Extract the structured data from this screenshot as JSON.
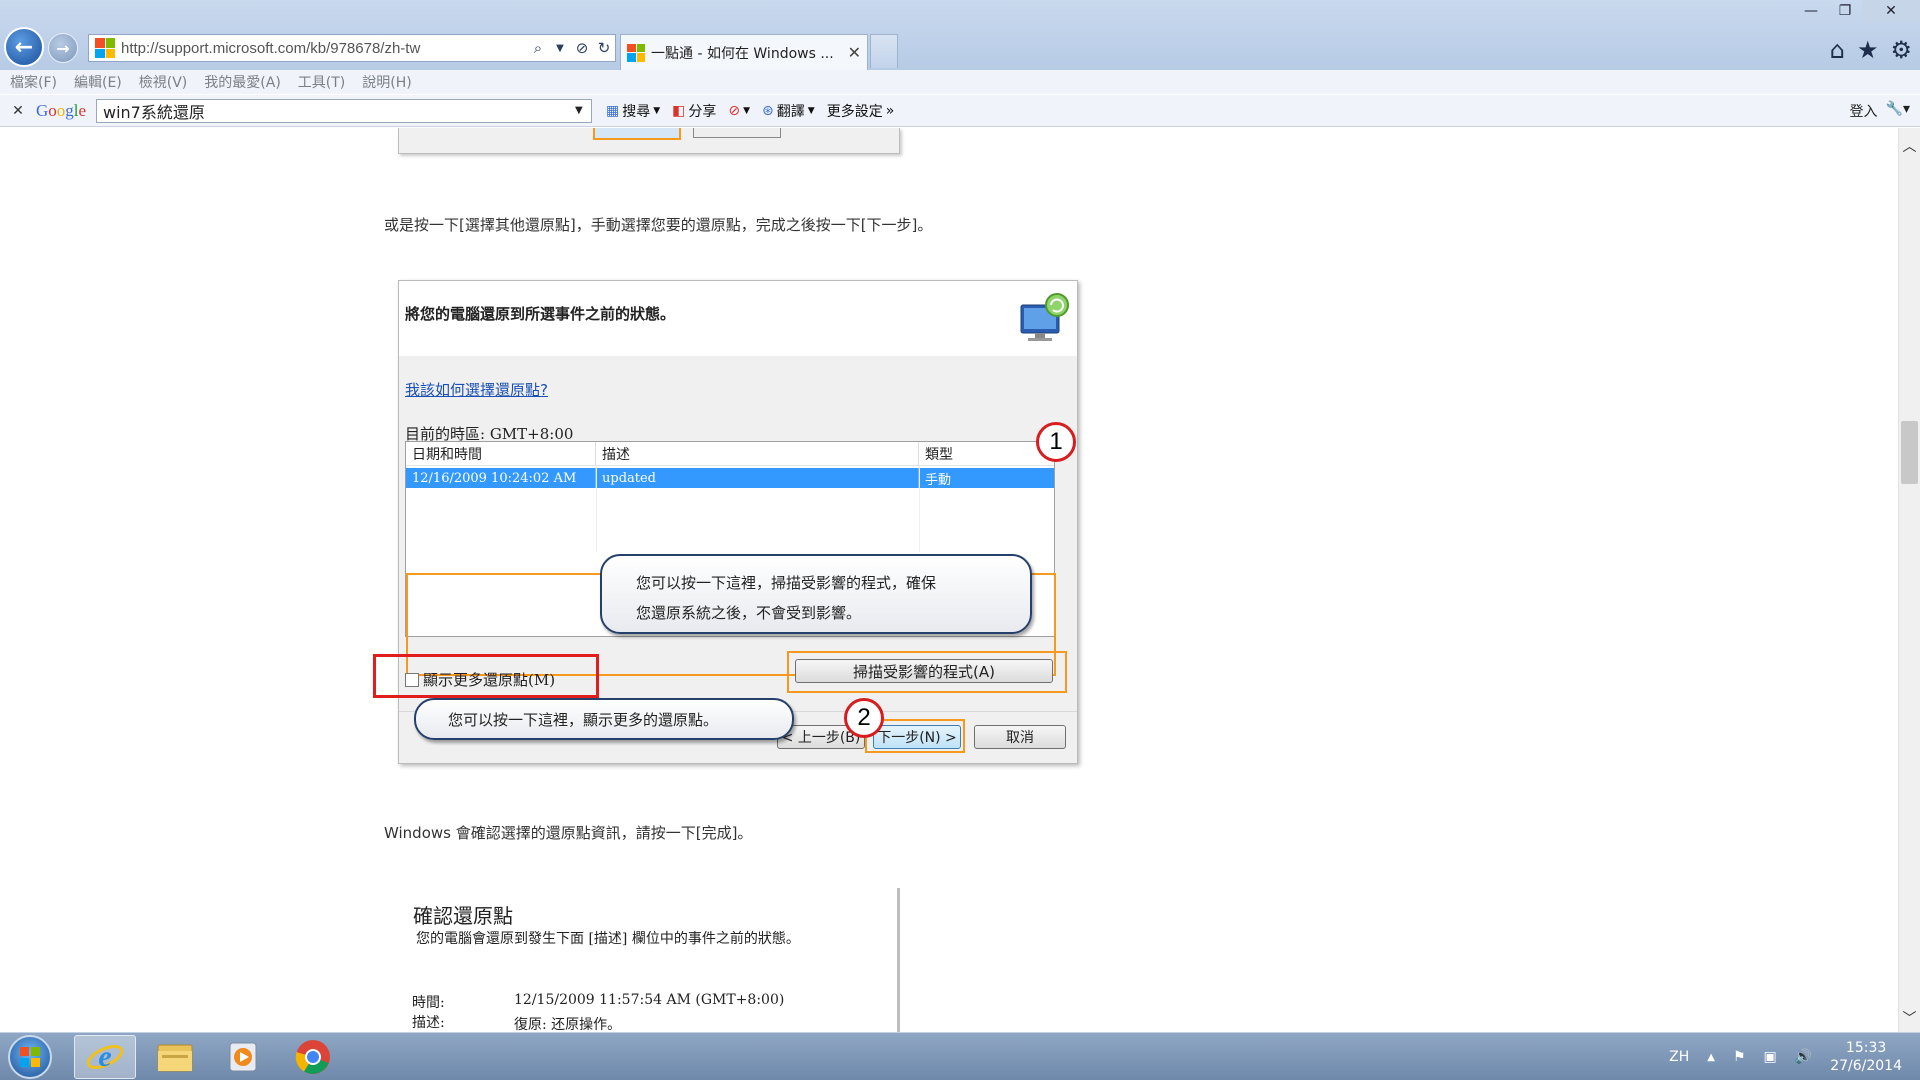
{
  "browser": {
    "url": "http://support.microsoft.com/kb/978678/zh-tw",
    "active_tab_title": "一點通 - 如何在 Windows ...",
    "menu": [
      "檔案(F)",
      "編輯(E)",
      "檢視(V)",
      "我的最愛(A)",
      "工具(T)",
      "說明(H)"
    ]
  },
  "google_toolbar": {
    "logo": "Google",
    "search_value": "win7系統還原",
    "search_label": "搜尋",
    "share_label": "分享",
    "translate_label": "翻譯",
    "more_label": "更多設定",
    "signin_label": "登入"
  },
  "content": {
    "para1": "或是按一下[選擇其他還原點]，手動選擇您要的還原點，完成之後按一下[下一步]。",
    "para2": "Windows 會確認選擇的還原點資訊，請按一下[完成]。"
  },
  "dialog": {
    "title": "將您的電腦還原到所選事件之前的狀態。",
    "help_link": "我該如何選擇還原點?",
    "timezone": "目前的時區: GMT+8:00",
    "columns": [
      "日期和時間",
      "描述",
      "類型"
    ],
    "row": {
      "date": "12/16/2009 10:24:02 AM",
      "desc": "updated",
      "type": "手動"
    },
    "show_more_label": "顯示更多還原點(M)",
    "scan_button": "掃描受影響的程式(A)",
    "prev_button": "< 上一步(B)",
    "next_button": "下一步(N) >",
    "cancel_button": "取消",
    "callout_scan_line1": "您可以按一下這裡，掃描受影響的程式，確保",
    "callout_scan_line2": "您還原系統之後，不會受到影響。",
    "callout_more": "您可以按一下這裡，顯示更多的還原點。",
    "badge1": "1",
    "badge2": "2"
  },
  "confirm": {
    "title": "確認還原點",
    "desc": "您的電腦會還原到發生下面 [描述] 欄位中的事件之前的狀態。",
    "time_label": "時間:",
    "time_value": "12/15/2009 11:57:54 AM (GMT+8:00)",
    "desc_label": "描述:",
    "desc_value": "復原: 还原操作。"
  },
  "taskbar": {
    "lang": "ZH",
    "time": "15:33",
    "date": "27/6/2014"
  },
  "colors": {
    "highlight_orange": "#f59a1f",
    "highlight_red": "#e01e1e",
    "selection_blue": "#3399ff"
  }
}
